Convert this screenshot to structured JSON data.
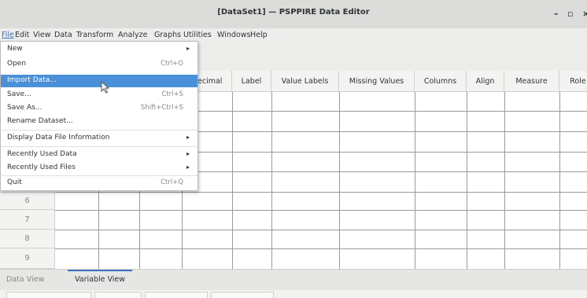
{
  "window": {
    "title": "[DataSet1] — PSPPIRE Data Editor",
    "controls": {
      "minimize": "–",
      "maximize": "▫",
      "close": "×"
    }
  },
  "menubar": [
    "File",
    "Edit",
    "View",
    "Data",
    "Transform",
    "Analyze",
    "Graphs",
    "Utilities",
    "Windows",
    "Help"
  ],
  "file_menu": [
    {
      "label": "New",
      "shortcut": "",
      "submenu": true
    },
    {
      "label": "Open",
      "shortcut": "Ctrl+O",
      "submenu": false
    },
    {
      "label": "Import Data...",
      "shortcut": "",
      "submenu": false,
      "highlighted": true
    },
    {
      "label": "Save...",
      "shortcut": "Ctrl+S",
      "submenu": false
    },
    {
      "label": "Save As...",
      "shortcut": "Shift+Ctrl+S",
      "submenu": false
    },
    {
      "label": "Rename Dataset...",
      "shortcut": "",
      "submenu": false
    },
    {
      "label": "Display Data File Information",
      "shortcut": "",
      "submenu": true
    },
    {
      "label": "Recently Used Data",
      "shortcut": "",
      "submenu": true
    },
    {
      "label": "Recently Used Files",
      "shortcut": "",
      "submenu": true
    },
    {
      "label": "Quit",
      "shortcut": "Ctrl+Q",
      "submenu": false
    }
  ],
  "grid": {
    "columns": [
      "ecimal",
      "Label",
      "Value Labels",
      "Missing Values",
      "Columns",
      "Align",
      "Measure",
      "Role"
    ],
    "rows": [
      "6",
      "7",
      "8",
      "9"
    ]
  },
  "tabs": {
    "data_view": "Data View",
    "variable_view": "Variable View"
  },
  "icons": {
    "submenu_arrow": "triangle-right-icon",
    "mouse_cursor": "arrow-pointer-icon"
  },
  "colors": {
    "highlight": "#4a90d9",
    "accent": "#3d71c2"
  }
}
